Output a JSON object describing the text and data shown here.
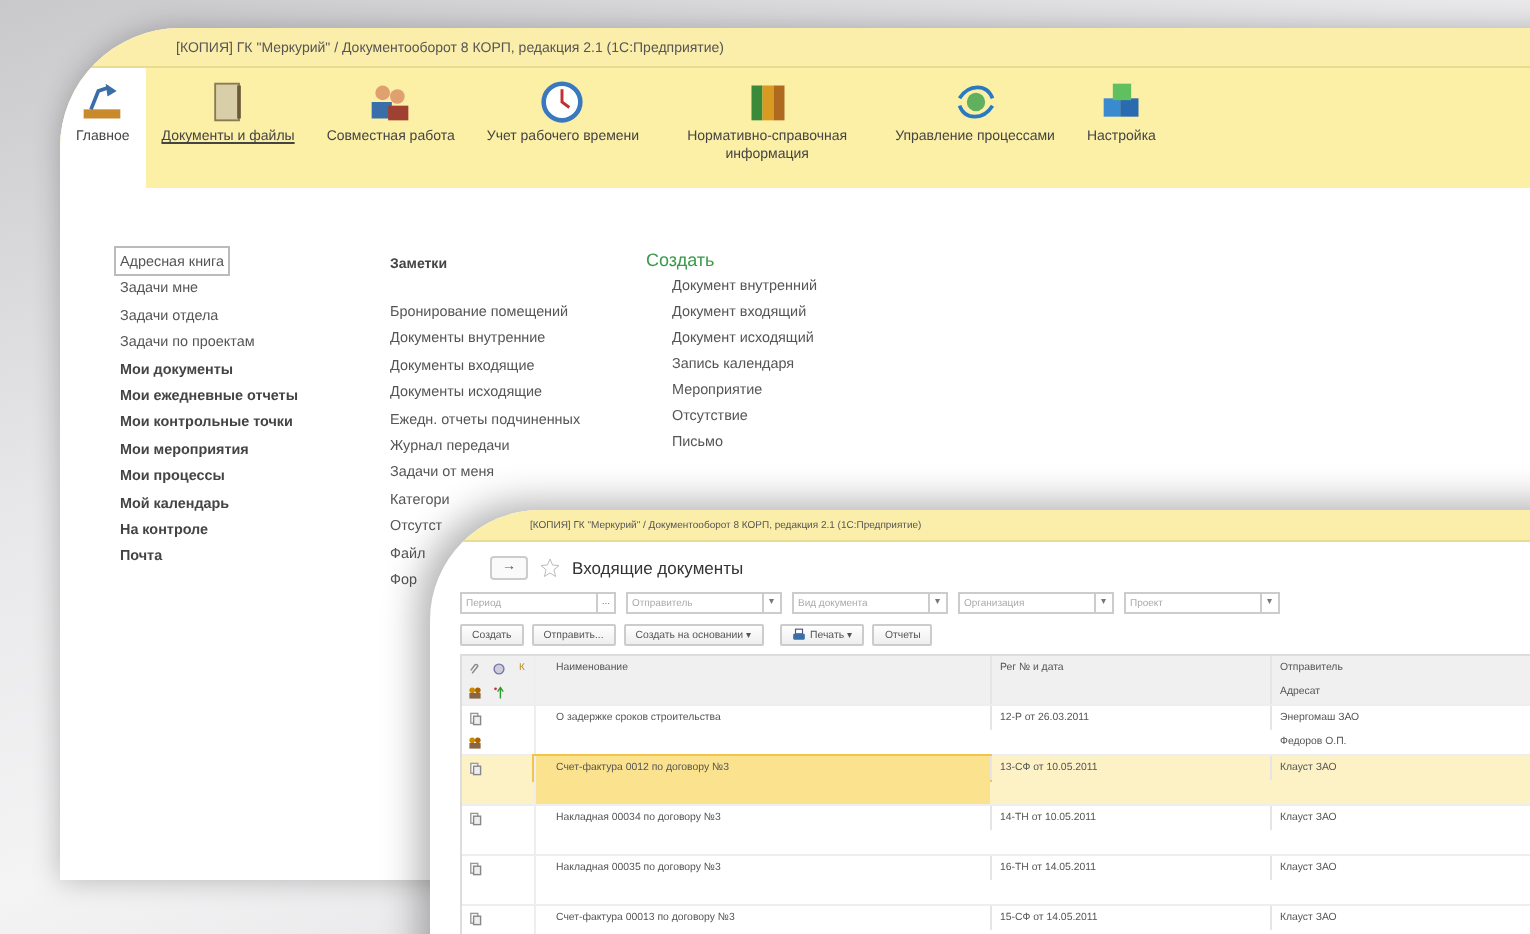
{
  "main_window": {
    "title": "[КОПИЯ] ГК \"Меркурий\" / Документооборот 8 КОРП, редакция 2.1   (1С:Предприятие)",
    "tabs": [
      {
        "label": "Главное",
        "selected": true,
        "link": false
      },
      {
        "label": "Документы и файлы",
        "selected": false,
        "link": true
      },
      {
        "label": "Совместная работа",
        "selected": false,
        "link": false
      },
      {
        "label": "Учет рабочего времени",
        "selected": false,
        "link": false
      },
      {
        "label": "Нормативно-справочная информация",
        "selected": false,
        "link": false
      },
      {
        "label": "Управление процессами",
        "selected": false,
        "link": false
      },
      {
        "label": "Настройка",
        "selected": false,
        "link": false
      }
    ],
    "left_links": [
      {
        "label": "Адресная книга",
        "selected": true,
        "bold": false
      },
      {
        "label": "Задачи мне",
        "selected": false,
        "bold": false
      },
      {
        "label": "Задачи отдела",
        "selected": false,
        "bold": false
      },
      {
        "label": "Задачи по проектам",
        "selected": false,
        "bold": false
      },
      {
        "label": "Мои документы",
        "selected": false,
        "bold": true
      },
      {
        "label": "Мои ежедневные отчеты",
        "selected": false,
        "bold": true
      },
      {
        "label": "Мои контрольные точки",
        "selected": false,
        "bold": true
      },
      {
        "label": "Мои мероприятия",
        "selected": false,
        "bold": true
      },
      {
        "label": "Мои процессы",
        "selected": false,
        "bold": true
      },
      {
        "label": "Мой календарь",
        "selected": false,
        "bold": true
      },
      {
        "label": "На контроле",
        "selected": false,
        "bold": true
      },
      {
        "label": "Почта",
        "selected": false,
        "bold": true
      }
    ],
    "notes_heading": "Заметки",
    "middle_links": [
      "Бронирование помещений",
      "Документы внутренние",
      "Документы входящие",
      "Документы исходящие",
      "Ежедн. отчеты подчиненных",
      "Журнал передачи",
      "Задачи от меня",
      "Категори",
      "Отсутст",
      "Файл",
      "Фор"
    ],
    "create_heading": "Создать",
    "create_links": [
      "Документ внутренний",
      "Документ входящий",
      "Документ исходящий",
      "Запись календаря",
      "Мероприятие",
      "Отсутствие",
      "Письмо"
    ]
  },
  "list_window": {
    "title": "[КОПИЯ] ГК \"Меркурий\" / Документооборот 8 КОРП, редакция 2.1   (1С:Предприятие)",
    "forward": "→",
    "heading": "Входящие документы",
    "filters": [
      {
        "placeholder": "Период",
        "button": "..."
      },
      {
        "placeholder": "Отправитель",
        "button": "▾"
      },
      {
        "placeholder": "Вид документа",
        "button": "▾"
      },
      {
        "placeholder": "Организация",
        "button": "▾"
      },
      {
        "placeholder": "Проект",
        "button": "▾"
      }
    ],
    "buttons": [
      {
        "label": "Создать",
        "kind": "plain"
      },
      {
        "label": "Отправить...",
        "kind": "plain"
      },
      {
        "label": "Создать на основании ▾",
        "kind": "plain"
      },
      {
        "label": "Печать ▾",
        "kind": "print"
      },
      {
        "label": "Отчеты",
        "kind": "plain"
      }
    ],
    "columns": {
      "flag": "К",
      "name": "Наименование",
      "reg": "Рег № и дата",
      "sender": "Отправитель",
      "addressee": "Адресат"
    },
    "rows": [
      {
        "name": "О задержке сроков строительства",
        "reg": "12-Р от 26.03.2011",
        "sender": "Энергомаш ЗАО",
        "addressee": "Федоров О.П.",
        "selected": false
      },
      {
        "name": "Счет-фактура 0012 по договору №3",
        "reg": "13-СФ от 10.05.2011",
        "sender": "Клауст ЗАО",
        "selected": true
      },
      {
        "name": "Накладная 00034 по договору №3",
        "reg": "14-ТН от 10.05.2011",
        "sender": "Клауст ЗАО",
        "selected": false
      },
      {
        "name": "Накладная 00035 по договору №3",
        "reg": "16-ТН от 14.05.2011",
        "sender": "Клауст ЗАО",
        "selected": false
      },
      {
        "name": "Счет-фактура 00013 по договору №3",
        "reg": "15-СФ от 14.05.2011",
        "sender": "Клауст ЗАО",
        "selected": false
      }
    ]
  }
}
